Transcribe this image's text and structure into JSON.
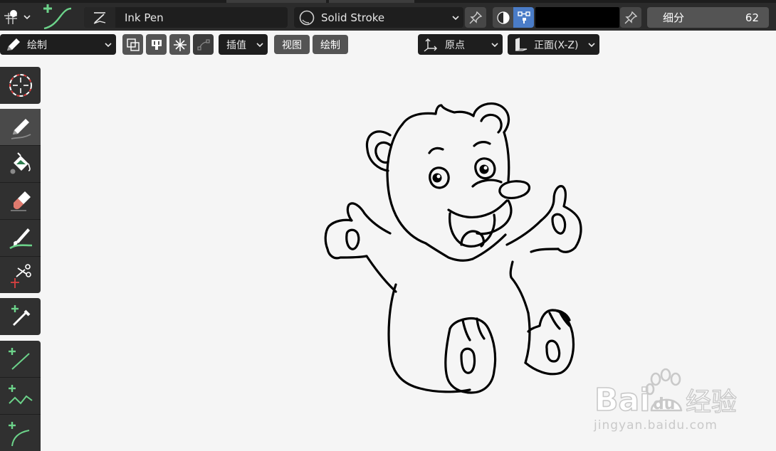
{
  "header": {
    "brush_name": "Ink Pen",
    "material_name": "Solid Stroke",
    "subdivision_label": "细分",
    "subdivision_value": "62",
    "stroke_color": "#000000"
  },
  "subheader": {
    "mode_label": "绘制",
    "interpolate_label": "插值",
    "view_label": "视图",
    "draw_label": "绘制",
    "origin_label": "原点",
    "plane_label": "正面(X-Z)"
  },
  "toolbar": {
    "tools": [
      "cursor-tool",
      "draw-tool",
      "fill-tool",
      "erase-tool",
      "tint-tool",
      "cutter-tool",
      "eyedropper-tool",
      "line-tool",
      "polyline-tool",
      "arc-tool"
    ]
  },
  "watermark": {
    "logo_text": "Bai du 经验",
    "url_text": "jingyan.baidu.com"
  },
  "colors": {
    "accent_green": "#6cd38a",
    "header_bg": "#2b2b2b",
    "field_bg": "#1e1e1e",
    "button_bg": "#545454",
    "canvas_bg": "#f5f5f5",
    "active_blue": "#4a7cc7"
  }
}
